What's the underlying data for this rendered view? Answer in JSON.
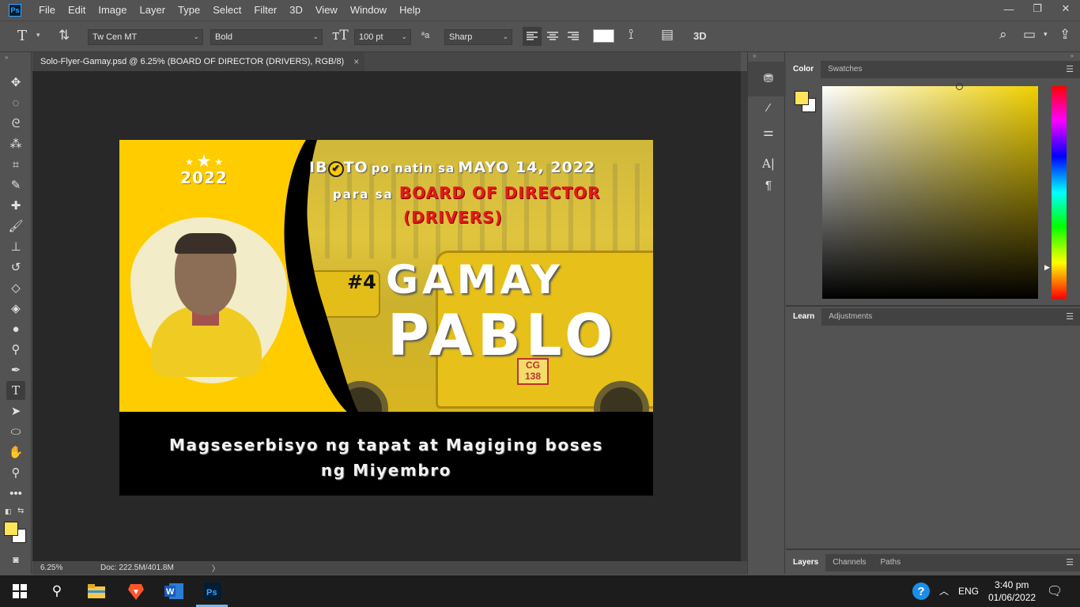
{
  "menu": [
    "File",
    "Edit",
    "Image",
    "Layer",
    "Type",
    "Select",
    "Filter",
    "3D",
    "View",
    "Window",
    "Help"
  ],
  "app_logo": "Ps",
  "window_controls": {
    "minimize": "—",
    "restore": "❐",
    "close": "✕"
  },
  "options": {
    "font_family": "Tw Cen MT",
    "font_style": "Bold",
    "font_size": "100 pt",
    "antialias": "Sharp",
    "aa_symbol": "ªa",
    "three_d": "3D"
  },
  "document": {
    "tab_title": "Solo-Flyer-Gamay.psd @ 6.25% (BOARD OF DIRECTOR  (DRIVERS), RGB/8)",
    "close": "×",
    "zoom": "6.25%",
    "doc_size": "Doc: 222.5M/401.8M",
    "arrow": "〉"
  },
  "artwork": {
    "year": "2022",
    "iboto_pre": "IB",
    "iboto_post": "TO",
    "check_glyph": "✔",
    "po_natin_sa": "po natin sa",
    "date": "MAYO 14, 2022",
    "para_sa": "para sa",
    "position": "BOARD OF DIRECTOR",
    "position_sub": "(DRIVERS)",
    "number": "#4",
    "first_name": "GAMAY",
    "last_name": "PABLO",
    "tagline_1": "Magseserbisyo ng tapat at Magiging boses",
    "tagline_2": "ng Miyembro",
    "plate_top": "CG",
    "plate_bottom": "138"
  },
  "panels": {
    "color_tabs": [
      "Color",
      "Swatches"
    ],
    "learn_tabs": [
      "Learn",
      "Adjustments"
    ],
    "layers_tabs": [
      "Layers",
      "Channels",
      "Paths"
    ],
    "menu_glyph": "☰",
    "foreground_color": "#ffe45a",
    "background_color": "#ffffff"
  },
  "taskbar": {
    "language": "ENG",
    "time": "3:40 pm",
    "date": "01/06/2022"
  }
}
